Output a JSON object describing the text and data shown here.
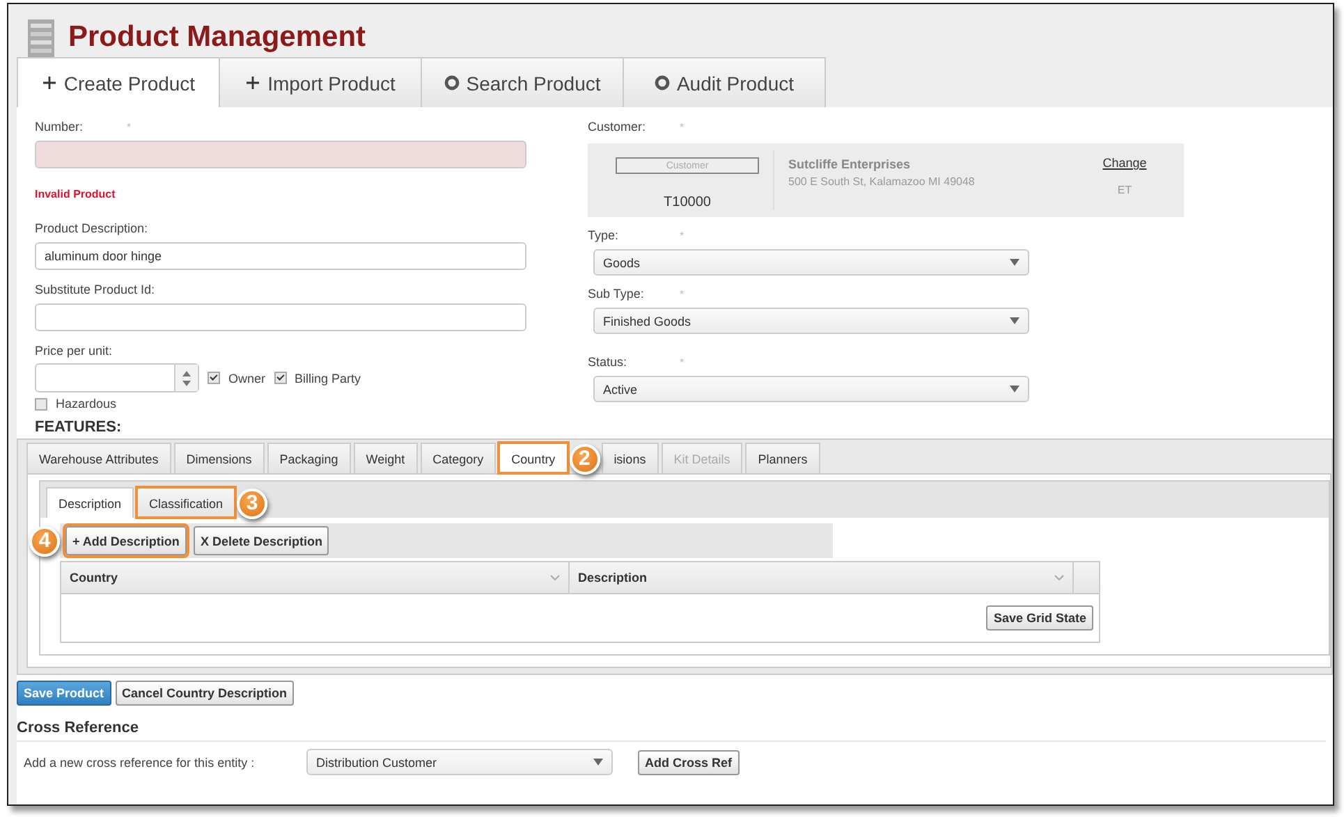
{
  "header": {
    "title": "Product Management"
  },
  "top_tabs": [
    {
      "label": "Create Product",
      "kind": "create",
      "selected": true
    },
    {
      "label": "Import Product",
      "kind": "create",
      "selected": false
    },
    {
      "label": "Search Product",
      "kind": "view",
      "selected": false
    },
    {
      "label": "Audit Product",
      "kind": "view",
      "selected": false
    }
  ],
  "number": {
    "label": "Number:",
    "mark": "*",
    "invalid": true,
    "error": "Invalid Product"
  },
  "description": {
    "label": "Product Description:",
    "value": "aluminum door hinge"
  },
  "substitute": {
    "label": "Substitute Product Id:"
  },
  "price": {
    "label": "Price per unit:"
  },
  "flags": [
    {
      "label": "Owner",
      "checked": true
    },
    {
      "label": "Billing Party",
      "checked": true
    }
  ],
  "hazardous": {
    "label": "Hazardous",
    "checked": false
  },
  "customer": {
    "label": "Customer:",
    "mark": "*",
    "button": "Customer",
    "code": "T10000",
    "name": "Sutcliffe Enterprises",
    "address": "500 E South St, Kalamazoo MI 49048",
    "link": "Change",
    "tag": "ET"
  },
  "selects": [
    {
      "label": "Type:",
      "mark": "*",
      "value": "Goods"
    },
    {
      "label": "Sub Type:",
      "mark": "*",
      "value": "Finished Goods"
    },
    {
      "label": "Status:",
      "mark": "*",
      "value": "Active"
    }
  ],
  "features": {
    "title": "FEATURES:",
    "tabs": [
      {
        "label": "Warehouse Attributes",
        "selected": false,
        "disabled": false,
        "highlighted": false
      },
      {
        "label": "Dimensions",
        "selected": false,
        "disabled": false,
        "highlighted": false
      },
      {
        "label": "Packaging",
        "selected": false,
        "disabled": false,
        "highlighted": false
      },
      {
        "label": "Weight",
        "selected": false,
        "disabled": false,
        "highlighted": false
      },
      {
        "label": "Category",
        "selected": false,
        "disabled": false,
        "highlighted": false
      },
      {
        "label": "Country",
        "selected": true,
        "disabled": false,
        "highlighted": true,
        "callout": "2"
      },
      {
        "label": "isions",
        "selected": false,
        "disabled": false,
        "highlighted": false
      },
      {
        "label": "Kit Details",
        "selected": false,
        "disabled": true,
        "highlighted": false
      },
      {
        "label": "Planners",
        "selected": false,
        "disabled": false,
        "highlighted": false
      }
    ],
    "subtabs": [
      {
        "label": "Description",
        "selected": true,
        "highlighted": false
      },
      {
        "label": "Classification",
        "selected": false,
        "highlighted": true,
        "callout": "3"
      }
    ],
    "toolbar": [
      {
        "label": "+ Add Description",
        "highlighted": true,
        "callout": "4"
      },
      {
        "label": "X Delete Description",
        "highlighted": false
      }
    ],
    "grid": {
      "columns": [
        "Country",
        "Description"
      ],
      "save_button": "Save Grid State"
    }
  },
  "actions": [
    {
      "label": "Save Product",
      "primary": true
    },
    {
      "label": "Cancel Country Description",
      "primary": false
    }
  ],
  "cross_reference": {
    "title": "Cross Reference",
    "label": "Add a new cross reference for this entity :",
    "value": "Distribution Customer",
    "button": "Add Cross Ref"
  }
}
